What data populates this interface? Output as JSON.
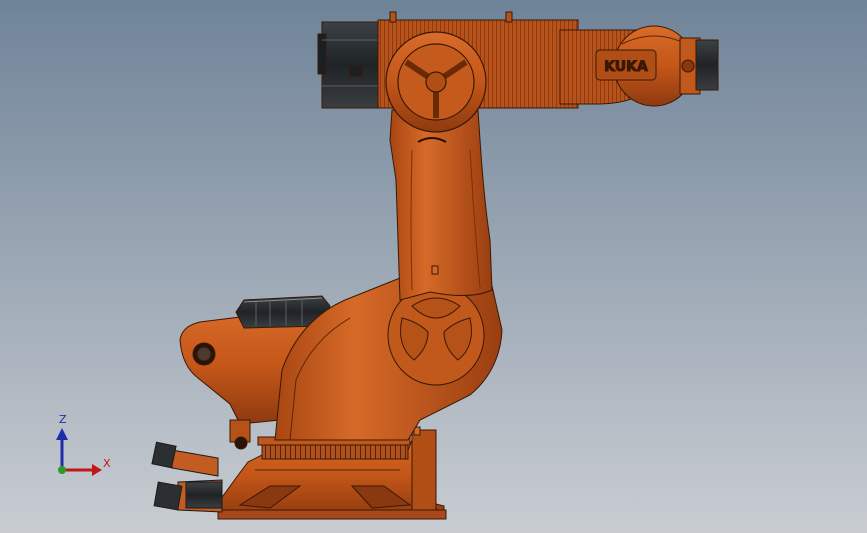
{
  "scene": {
    "background_top": "#6f8398",
    "background_bottom": "#c9cdd2"
  },
  "robot": {
    "body_color": "#c85a1c",
    "shade_color": "#9a3e10",
    "highlight_color": "#e0783a",
    "outline_color": "#3a1805",
    "motor_color": "#2a2d30",
    "brand_text": "KUKA"
  },
  "triad": {
    "z_label": "Z",
    "x_label": "X",
    "z_color": "#1e2ea8",
    "x_color": "#c01818",
    "origin_color": "#2a9a2a"
  }
}
